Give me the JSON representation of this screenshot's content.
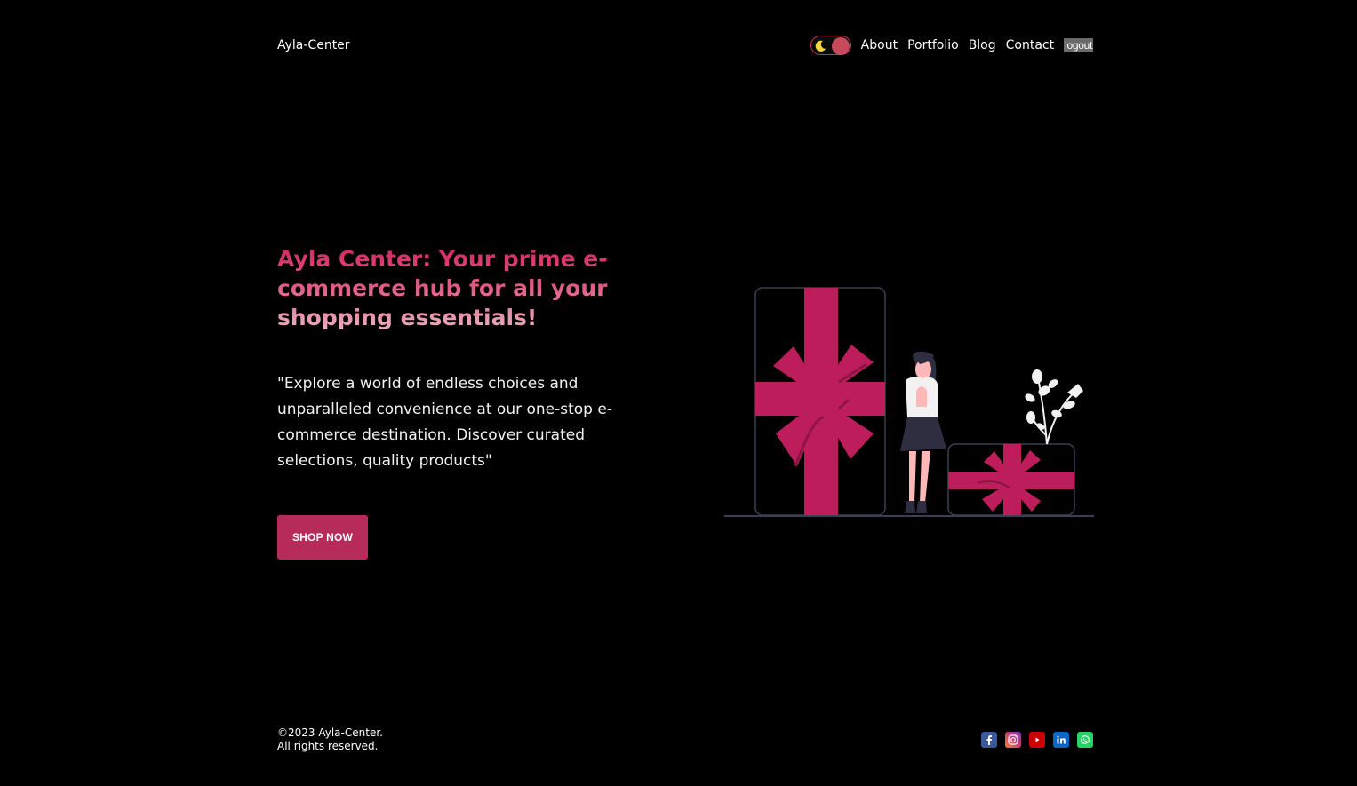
{
  "header": {
    "logo": "Ayla-Center",
    "theme_toggle": {
      "icon": "moon-icon",
      "state": "dark"
    },
    "nav": [
      {
        "label": "About"
      },
      {
        "label": "Portfolio"
      },
      {
        "label": "Blog"
      },
      {
        "label": "Contact"
      }
    ],
    "logout_label": "logout"
  },
  "hero": {
    "title": "Ayla Center: Your prime e-commerce hub for all your shopping essentials!",
    "description": "\"Explore a world of endless choices and unparalleled convenience at our one-stop e-commerce destination. Discover curated selections, quality products\"",
    "cta_label": "SHOP NOW",
    "illustration": "gift-boxes-woman-illustration"
  },
  "footer": {
    "copyright": "©2023 Ayla-Center.",
    "rights": "All rights reserved.",
    "socials": [
      {
        "icon": "facebook-icon",
        "color": "#3b5998"
      },
      {
        "icon": "instagram-icon",
        "color": "#c13584"
      },
      {
        "icon": "youtube-icon",
        "color": "#cc0000"
      },
      {
        "icon": "linkedin-icon",
        "color": "#0a66c2"
      },
      {
        "icon": "whatsapp-icon",
        "color": "#25d366"
      }
    ]
  },
  "colors": {
    "background": "#000000",
    "accent": "#b72b5a",
    "ribbon": "#be1d5b",
    "title_gradient": [
      "#d4235e",
      "#e8b5bd"
    ]
  }
}
